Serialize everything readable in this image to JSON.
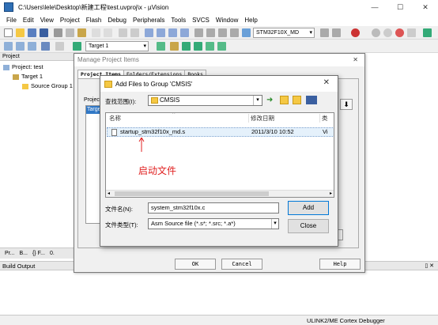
{
  "window": {
    "title": "C:\\Users\\lele\\Desktop\\新建工程\\test.uvproj\\x - µVision",
    "minimize": "—",
    "maximize": "☐",
    "close": "✕"
  },
  "menu": [
    "File",
    "Edit",
    "View",
    "Project",
    "Flash",
    "Debug",
    "Peripherals",
    "Tools",
    "SVCS",
    "Window",
    "Help"
  ],
  "toolbar": {
    "device_combo": "STM32F10X_MD",
    "target_combo": "Target 1"
  },
  "project_panel": {
    "header": "Project",
    "tree": [
      "Project: test",
      "Target 1",
      "Source Group 1"
    ],
    "tabs": [
      "Pr...",
      "B...",
      "{} F...",
      "0."
    ]
  },
  "build_output": {
    "header": "Build Output",
    "pin": "▯ ✕"
  },
  "status": {
    "debugger": "ULINK2/ME Cortex Debugger"
  },
  "manage_dialog": {
    "title": "Manage Project Items",
    "close": "✕",
    "tabs": [
      "Project Items",
      "Folders/Extensions",
      "Books"
    ],
    "project_label": "Projec",
    "project_selected": "Targe",
    "down_arrow": "⬇",
    "ok": "OK",
    "cancel": "Cancel",
    "help": "Help"
  },
  "add_dialog": {
    "title": "Add Files to Group 'CMSIS'",
    "close": "✕",
    "look_in_label": "查找范围(I):",
    "look_in_value": "CMSIS",
    "columns": {
      "name": "名称",
      "date": "修改日期",
      "type": "类"
    },
    "file": {
      "name": "startup_stm32f10x_md.s",
      "date": "2011/3/10 10:52",
      "type": "Vi"
    },
    "annotation": "启动文件",
    "filename_label": "文件名(N):",
    "filename_value": "system_stm32f10x.c",
    "filetype_label": "文件类型(T):",
    "filetype_value": "Asm Source file (*.s*; *.src; *.a*)",
    "add": "Add",
    "close_button": "Close"
  },
  "colors": {
    "annotation": "#e02020",
    "selection": "#3178c6",
    "folder": "#f5c844"
  }
}
